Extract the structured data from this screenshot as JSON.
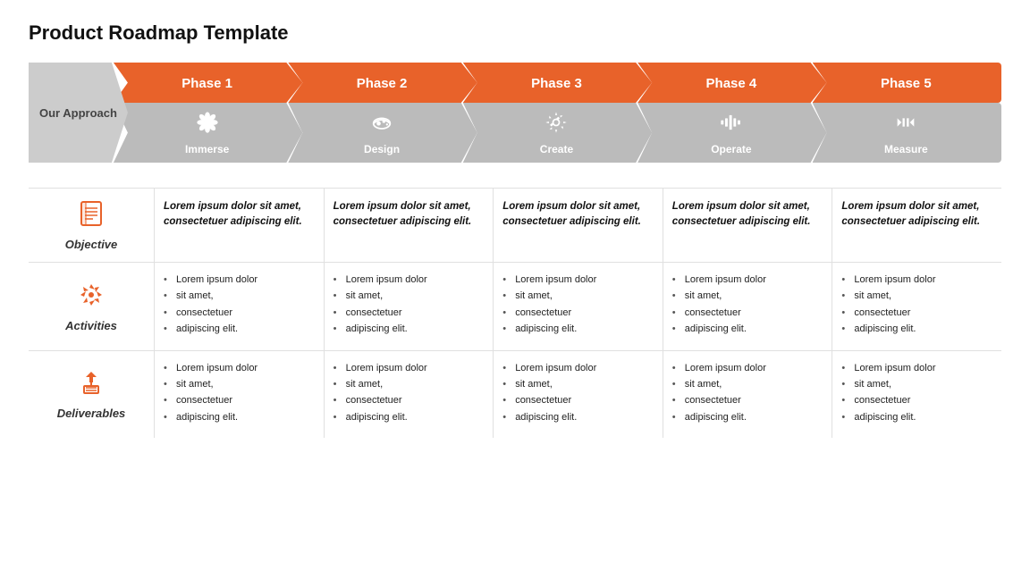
{
  "title": "Product Roadmap Template",
  "our_approach_label": "Our Approach",
  "phases": [
    {
      "id": 1,
      "label": "Phase 1",
      "sub_label": "Immerse",
      "icon": "🌐"
    },
    {
      "id": 2,
      "label": "Phase 2",
      "sub_label": "Design",
      "icon": "🎨"
    },
    {
      "id": 3,
      "label": "Phase 3",
      "sub_label": "Create",
      "icon": "⚙️"
    },
    {
      "id": 4,
      "label": "Phase 4",
      "sub_label": "Operate",
      "icon": "📊"
    },
    {
      "id": 5,
      "label": "Phase 5",
      "sub_label": "Measure",
      "icon": "◀▶"
    }
  ],
  "rows": [
    {
      "id": "objective",
      "label": "Objective",
      "type": "objective",
      "cells": [
        "Lorem ipsum dolor sit amet, consectetuer adipiscing elit.",
        "Lorem ipsum dolor sit amet, consectetuer adipiscing elit.",
        "Lorem ipsum dolor sit amet, consectetuer adipiscing elit.",
        "Lorem ipsum dolor sit amet, consectetuer adipiscing elit.",
        "Lorem ipsum dolor sit amet, consectetuer adipiscing elit."
      ]
    },
    {
      "id": "activities",
      "label": "Activities",
      "type": "list",
      "cells": [
        [
          "Lorem ipsum dolor",
          "sit amet,",
          "consectetuer",
          "adipiscing elit."
        ],
        [
          "Lorem ipsum dolor",
          "sit amet,",
          "consectetuer",
          "adipiscing elit."
        ],
        [
          "Lorem ipsum dolor",
          "sit amet,",
          "consectetuer",
          "adipiscing elit."
        ],
        [
          "Lorem ipsum dolor",
          "sit amet,",
          "consectetuer",
          "adipiscing elit."
        ],
        [
          "Lorem ipsum dolor",
          "sit amet,",
          "consectetuer",
          "adipiscing elit."
        ]
      ]
    },
    {
      "id": "deliverables",
      "label": "Deliverables",
      "type": "list",
      "cells": [
        [
          "Lorem ipsum dolor",
          "sit amet,",
          "consectetuer",
          "adipiscing elit."
        ],
        [
          "Lorem ipsum dolor",
          "sit amet,",
          "consectetuer",
          "adipiscing elit."
        ],
        [
          "Lorem ipsum dolor",
          "sit amet,",
          "consectetuer",
          "adipiscing elit."
        ],
        [
          "Lorem ipsum dolor",
          "sit amet,",
          "consectetuer",
          "adipiscing elit."
        ],
        [
          "Lorem ipsum dolor",
          "sit amet,",
          "consectetuer",
          "adipiscing elit."
        ]
      ]
    }
  ],
  "colors": {
    "orange": "#E8622A",
    "gray_arrow": "#bbb",
    "our_approach_bg": "#c0c0c0"
  }
}
